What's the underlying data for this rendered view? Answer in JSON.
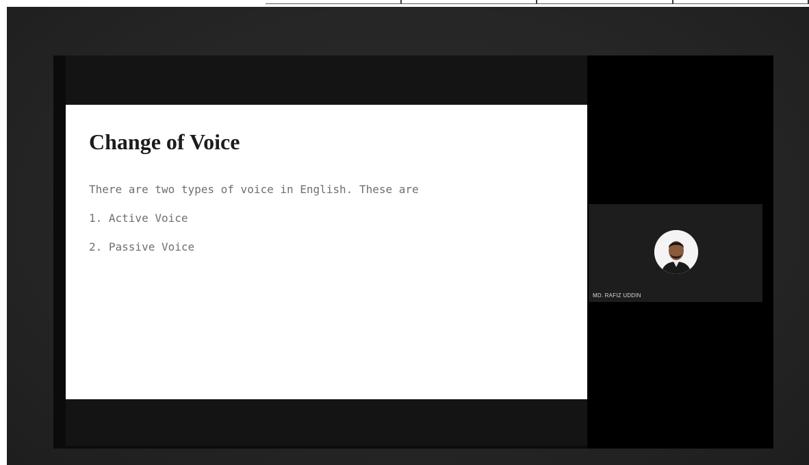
{
  "slide": {
    "title": "Change of Voice",
    "intro": "There are two types of voice in English. These are",
    "items": [
      "1. Active Voice",
      "2. Passive Voice"
    ]
  },
  "participant": {
    "name": "MD. RAFIZ UDDIN",
    "avatar_icon": "person-avatar"
  },
  "colors": {
    "background": "#262626",
    "slide": "#ffffff",
    "panel": "#000000",
    "tile": "#1d1d1d"
  }
}
